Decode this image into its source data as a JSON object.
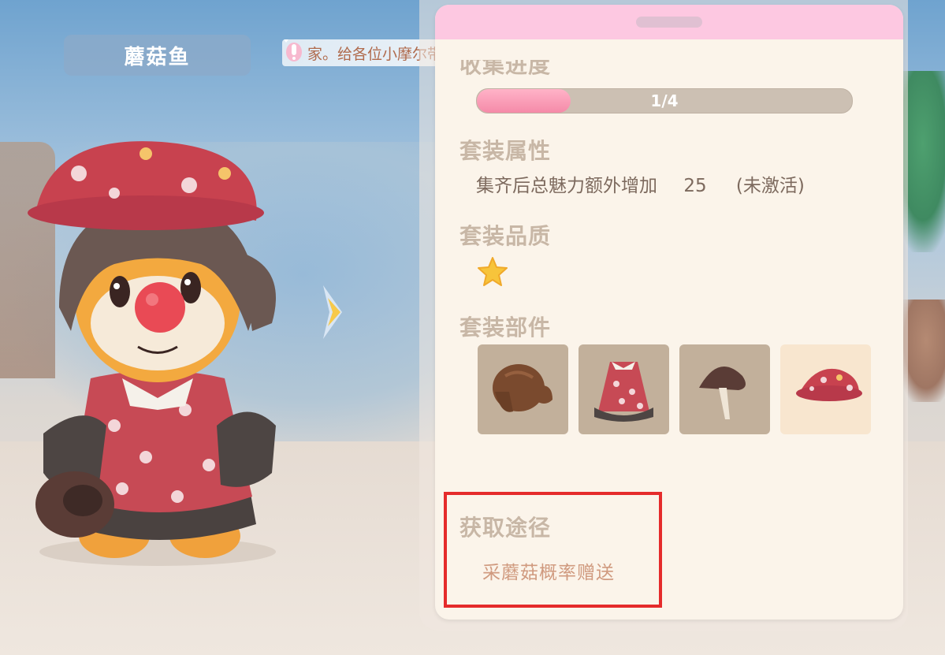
{
  "character": {
    "name": "蘑菇鱼"
  },
  "notice": {
    "text": "家。给各位小摩尔带来的不便，我们深表歉"
  },
  "panel": {
    "collect": {
      "title": "收集进度",
      "progress_text": "1/4",
      "progress": 0.25
    },
    "attributes": {
      "title": "套装属性",
      "desc": "集齐后总魅力额外增加",
      "value": "25",
      "status": "(未激活)"
    },
    "quality": {
      "title": "套装品质",
      "stars": 1
    },
    "parts": {
      "title": "套装部件",
      "items": [
        {
          "icon": "hair-icon",
          "owned": false
        },
        {
          "icon": "dress-icon",
          "owned": false
        },
        {
          "icon": "mushroom-icon",
          "owned": false
        },
        {
          "icon": "mushroom-hat-icon",
          "owned": true
        }
      ]
    },
    "source": {
      "title": "获取途径",
      "text": "采蘑菇概率赠送"
    }
  },
  "colors": {
    "header_pink": "#fdc8e1",
    "panel_bg": "#fbf4ea",
    "progress_fill": "#f58aa8",
    "highlight_red": "#e52b2b"
  }
}
